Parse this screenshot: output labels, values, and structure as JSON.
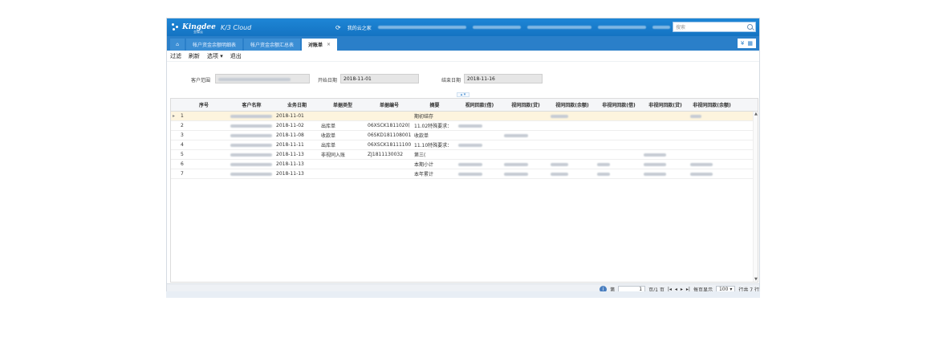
{
  "header": {
    "brand": "Kingdee",
    "product": "K/3 Cloud",
    "brand_sub": "金蝶云",
    "nav_label": "我的云之家",
    "search_placeholder": "搜索"
  },
  "tabs": [
    {
      "label": "帐户资金余额明细表"
    },
    {
      "label": "帐户资金余额汇总表"
    },
    {
      "label": "对账单",
      "active": true
    }
  ],
  "toolbar": {
    "filter": "过滤",
    "refresh": "刷新",
    "options": "选项",
    "exit": "退出"
  },
  "filters": {
    "customer_label": "客户范围",
    "start_label": "开始日期",
    "start_value": "2018-11-01",
    "end_label": "结束日期",
    "end_value": "2018-11-16"
  },
  "grid": {
    "columns": [
      "序号",
      "客户名称",
      "业务日期",
      "单据类型",
      "单据编号",
      "摘要",
      "视同回款(借)",
      "视同回款(贷)",
      "视同回款(余额)",
      "非视同回款(借)",
      "非视同回款(贷)",
      "非视同回款(余额)"
    ],
    "rows": [
      {
        "no": "1",
        "date": "2018-11-01",
        "type": "",
        "code": "",
        "summary": "期初结存"
      },
      {
        "no": "2",
        "date": "2018-11-02",
        "type": "出库单",
        "code": "06XSCK1811020(",
        "summary": "11.02特殊要求："
      },
      {
        "no": "3",
        "date": "2018-11-08",
        "type": "收款单",
        "code": "06SKD181108001",
        "summary": "收款单"
      },
      {
        "no": "4",
        "date": "2018-11-11",
        "type": "出库单",
        "code": "06XSCK18111100",
        "summary": "11.10特殊要求："
      },
      {
        "no": "5",
        "date": "2018-11-13",
        "type": "非视同入账",
        "code": "ZJ1811130032",
        "summary": "第三("
      },
      {
        "no": "6",
        "date": "2018-11-13",
        "type": "",
        "code": "",
        "summary": "本期小计"
      },
      {
        "no": "7",
        "date": "2018-11-13",
        "type": "",
        "code": "",
        "summary": "本年累计"
      }
    ]
  },
  "pager": {
    "page_prefix": "第",
    "page_value": "1",
    "page_suffix": "页/1 页",
    "per_page_label": "每页显示",
    "per_page_value": "100",
    "total": "行共 7 行"
  }
}
